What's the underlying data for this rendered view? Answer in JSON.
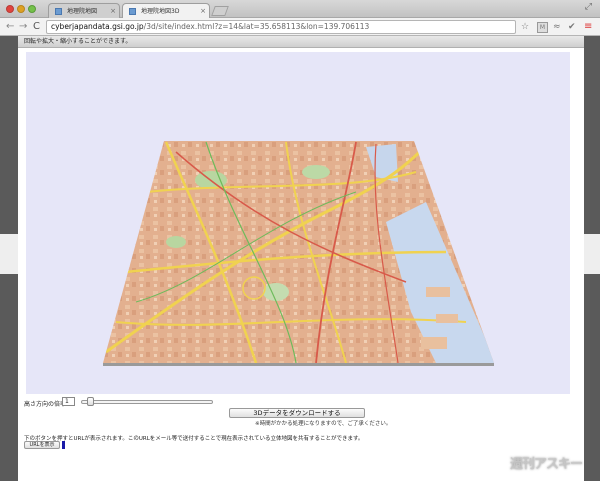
{
  "browser": {
    "tabs": [
      {
        "label": "地理院地図",
        "active": false
      },
      {
        "label": "地理院地図3D",
        "active": true
      }
    ],
    "url": {
      "host": "cyberjapandata.gsi.go.jp",
      "path": "/3d/site/index.html?z=14&lat=35.658113&lon=139.706113"
    },
    "icons": {
      "back": "back-arrow-icon",
      "forward": "forward-arrow-icon",
      "reload": "reload-icon",
      "star": "star-icon",
      "menu": "hamburger-menu-icon"
    },
    "glyphs": {
      "back": "←",
      "forward": "→",
      "reload": "C",
      "star": "☆",
      "ext1": "M",
      "ext2": "≈",
      "ext3": "✔",
      "menu": "≡",
      "tab_close": "×",
      "window": "⤢"
    }
  },
  "page": {
    "header_text": "回転や拡大・縮小することができます。",
    "height_label": "高さ方向の倍率=",
    "height_value": "1",
    "slider_value": 0.05,
    "download_button": "3Dデータをダウンロードする",
    "download_note": "※時間がかかる処理になりますので、ご了承ください。",
    "url_description": "下のボタンを押すとURLが表示されます。このURLをメール等で送付することで現在表示されている立体地図を共有することができます。",
    "url_button": "URLを表示"
  },
  "colors": {
    "viewer_bg": "#e6e6f8",
    "map_base": "#e3b08f",
    "water": "#c8d8ee",
    "roads_major": "#f0d250",
    "roads_red": "#d85a4a",
    "parks": "#b8d6a0"
  },
  "watermark": "週刊アスキー"
}
